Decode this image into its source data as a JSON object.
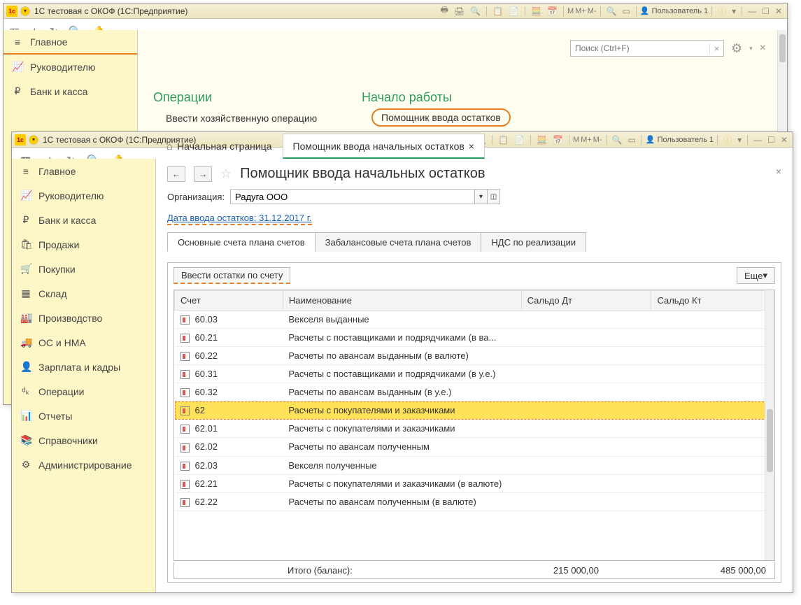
{
  "w1": {
    "title": "1С тестовая с ОКОФ  (1С:Предприятие)",
    "user": "Пользователь 1",
    "mlabels": [
      "M",
      "M+",
      "M-"
    ],
    "nav": [
      "Главное",
      "Руководителю",
      "Банк и касса"
    ],
    "search_placeholder": "Поиск (Ctrl+F)",
    "sec1": "Операции",
    "sec2": "Начало работы",
    "link1": "Ввести хозяйственную операцию",
    "pill": "Помощник ввода остатков"
  },
  "w2": {
    "title": "1С тестовая с ОКОФ  (1С:Предприятие)",
    "user": "Пользователь 1",
    "mlabels": [
      "M",
      "M+",
      "M-"
    ],
    "tab_home": "Начальная страница",
    "tab_active": "Помощник ввода начальных остатков",
    "nav": [
      "Главное",
      "Руководителю",
      "Банк и касса",
      "Продажи",
      "Покупки",
      "Склад",
      "Производство",
      "ОС и НМА",
      "Зарплата и кадры",
      "Операции",
      "Отчеты",
      "Справочники",
      "Администрирование"
    ],
    "page_title": "Помощник ввода начальных остатков",
    "org_label": "Организация:",
    "org_value": "Радуга ООО",
    "date_link": "Дата ввода остатков: 31.12.2017 г.",
    "tabs2": [
      "Основные счета плана счетов",
      "Забалансовые счета плана счетов",
      "НДС по реализации"
    ],
    "btn_enter": "Ввести остатки по счету",
    "btn_more": "Еще",
    "cols": [
      "Счет",
      "Наименование",
      "Сальдо Дт",
      "Сальдо Кт"
    ],
    "rows": [
      {
        "code": "60.03",
        "name": "Векселя выданные"
      },
      {
        "code": "60.21",
        "name": "Расчеты с поставщиками и подрядчиками (в ва..."
      },
      {
        "code": "60.22",
        "name": "Расчеты по авансам выданным (в валюте)"
      },
      {
        "code": "60.31",
        "name": "Расчеты с поставщиками и подрядчиками (в у.е.)"
      },
      {
        "code": "60.32",
        "name": "Расчеты по авансам выданным (в у.е.)"
      },
      {
        "code": "62",
        "name": "Расчеты с покупателями и заказчиками",
        "sel": true
      },
      {
        "code": "62.01",
        "name": "Расчеты с покупателями и заказчиками"
      },
      {
        "code": "62.02",
        "name": "Расчеты по авансам полученным"
      },
      {
        "code": "62.03",
        "name": "Векселя полученные"
      },
      {
        "code": "62.21",
        "name": "Расчеты с покупателями и заказчиками (в валюте)"
      },
      {
        "code": "62.22",
        "name": "Расчеты по авансам полученным (в валюте)"
      }
    ],
    "footer_label": "Итого (баланс):",
    "footer_dt": "215 000,00",
    "footer_kt": "485 000,00"
  }
}
